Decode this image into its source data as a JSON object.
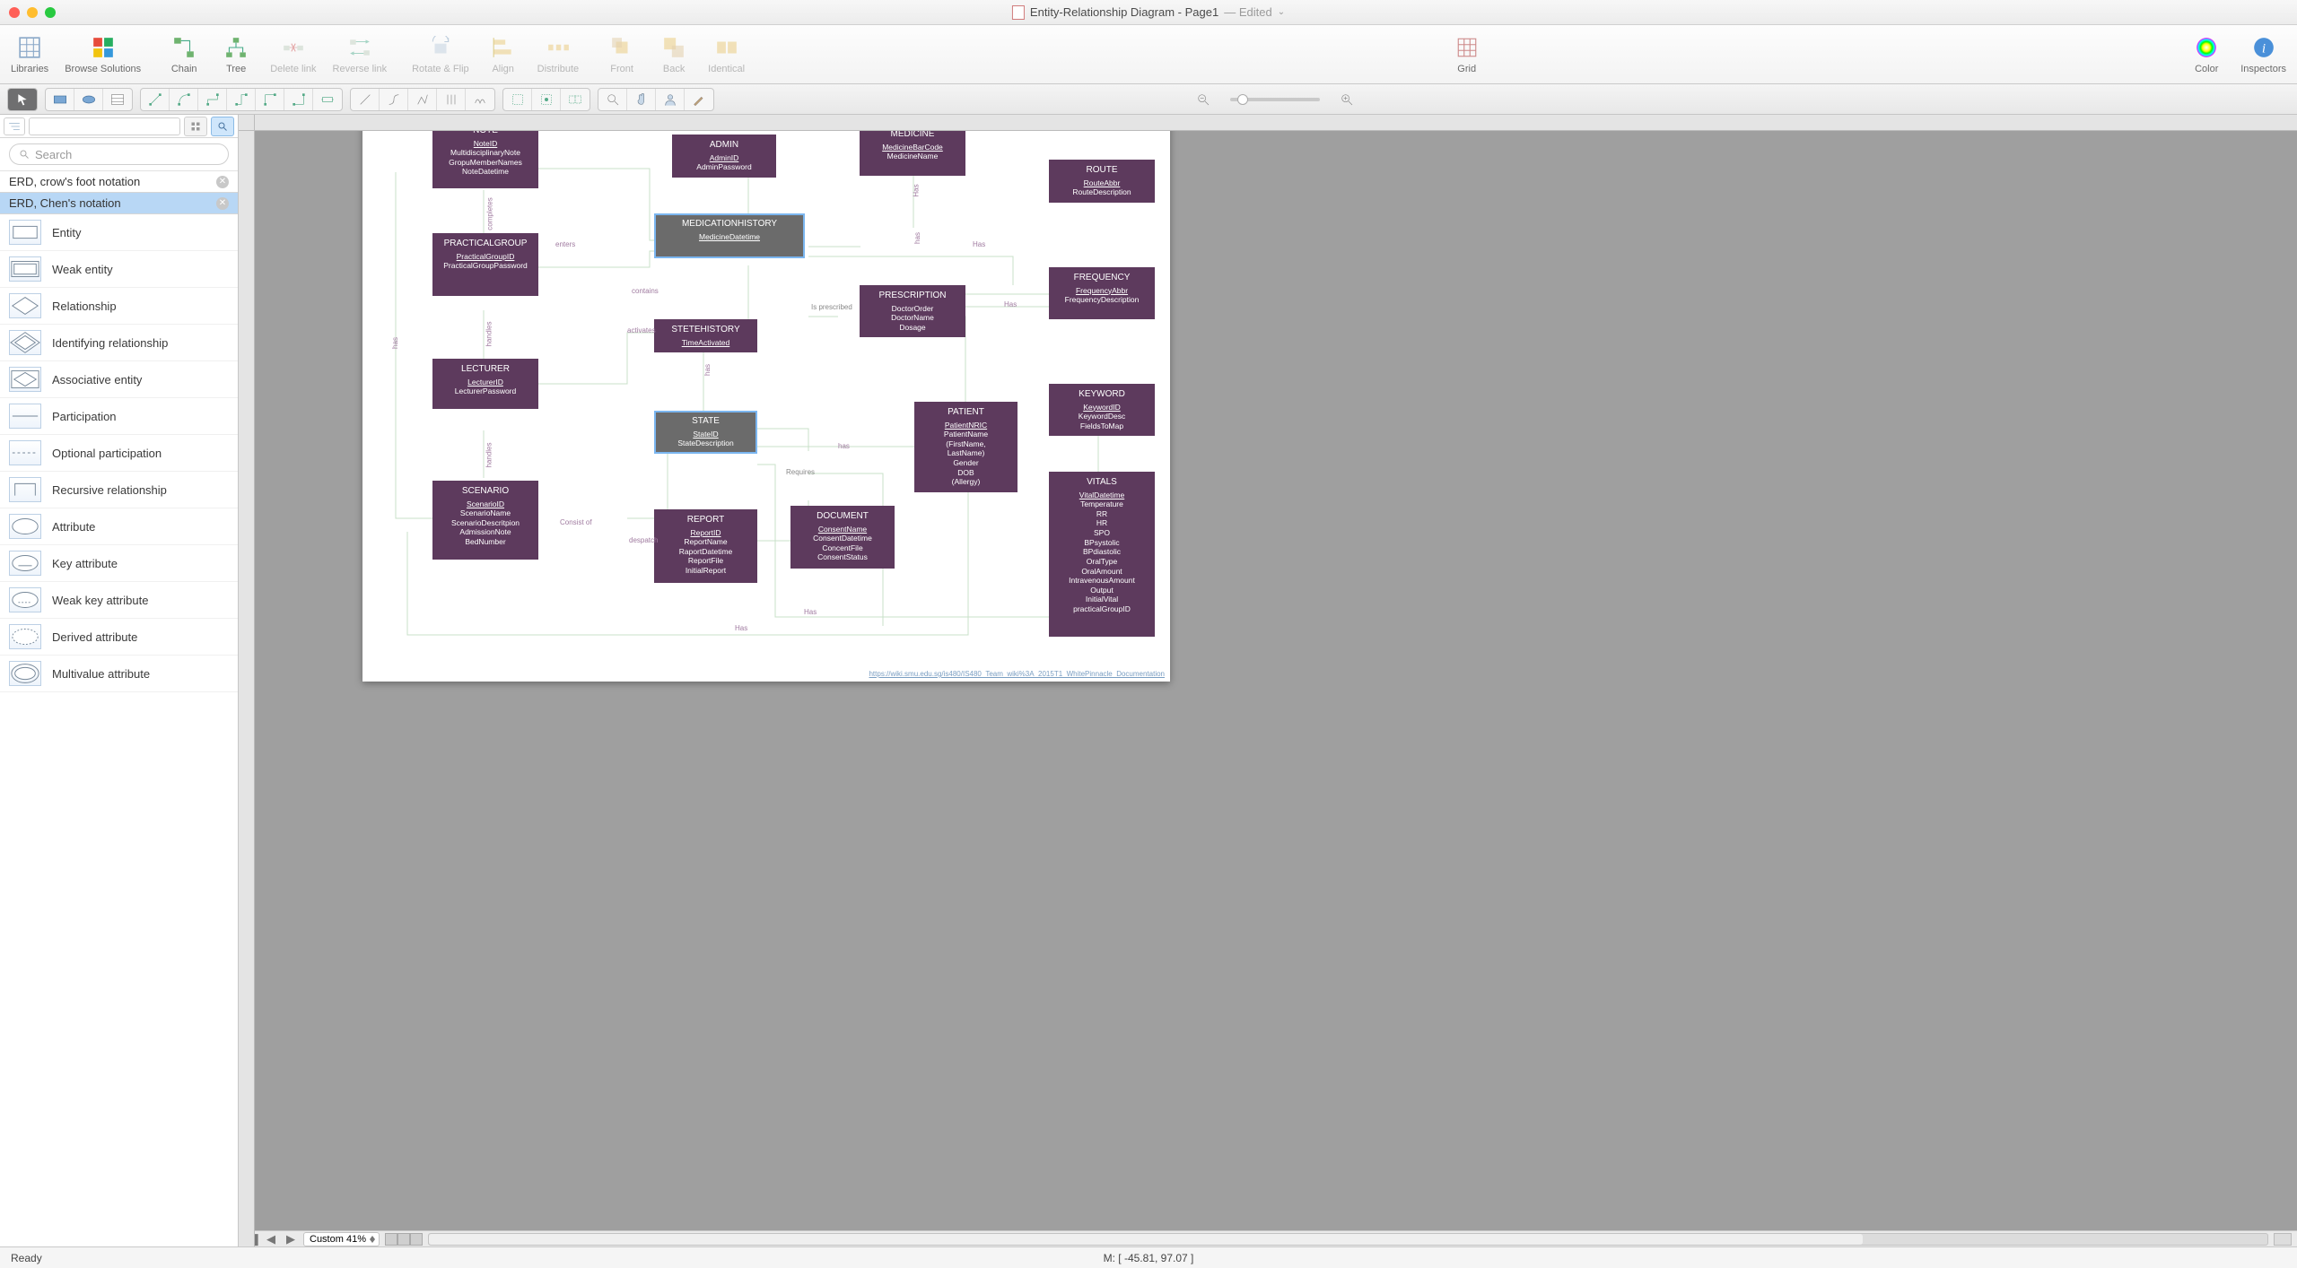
{
  "window": {
    "title": "Entity-Relationship Diagram - Page1",
    "edited": "— Edited"
  },
  "toolbar": {
    "libraries": "Libraries",
    "browse": "Browse Solutions",
    "chain": "Chain",
    "tree": "Tree",
    "delete_link": "Delete link",
    "reverse_link": "Reverse link",
    "rotate_flip": "Rotate & Flip",
    "align": "Align",
    "distribute": "Distribute",
    "front": "Front",
    "back": "Back",
    "identical": "Identical",
    "grid": "Grid",
    "color": "Color",
    "inspectors": "Inspectors"
  },
  "sidebar": {
    "search_placeholder": "Search",
    "stencil1": "ERD, crow's foot notation",
    "stencil2": "ERD, Chen's notation",
    "items": [
      "Entity",
      "Weak entity",
      "Relationship",
      "Identifying relationship",
      "Associative entity",
      "Participation",
      "Optional participation",
      "Recursive relationship",
      "Attribute",
      "Key attribute",
      "Weak key attribute",
      "Derived attribute",
      "Multivalue attribute"
    ]
  },
  "canvas": {
    "footer_url": "https://wiki.smu.edu.sg/is480/IS480_Team_wiki%3A_2015T1_WhitePinnacle_Documentation",
    "entities": {
      "note": {
        "name": "NOTE",
        "attrs": [
          "NoteID",
          "MultidisciplinaryNote",
          "GropuMemberNames",
          "NoteDatetime"
        ]
      },
      "admin": {
        "name": "ADMIN",
        "attrs": [
          "AdminID",
          "AdminPassword"
        ]
      },
      "medicine": {
        "name": "MEDICINE",
        "attrs": [
          "MedicineBarCode",
          "MedicineName"
        ]
      },
      "route": {
        "name": "ROUTE",
        "attrs": [
          "RouteAbbr",
          "RouteDescription"
        ]
      },
      "practicalgroup": {
        "name": "PRACTICALGROUP",
        "attrs": [
          "PracticalGroupID",
          "PracticalGroupPassword"
        ]
      },
      "medhistory": {
        "name": "MEDICATIONHISTORY",
        "attrs": [
          "MedicineDatetime"
        ]
      },
      "prescription": {
        "name": "PRESCRIPTION",
        "attrs": [
          "DoctorOrder",
          "DoctorName",
          "Dosage"
        ]
      },
      "frequency": {
        "name": "FREQUENCY",
        "attrs": [
          "FrequencyAbbr",
          "FrequencyDescription"
        ]
      },
      "lecturer": {
        "name": "LECTURER",
        "attrs": [
          "LecturerID",
          "LecturerPassword"
        ]
      },
      "statehistory": {
        "name": "STETEHISTORY",
        "attrs": [
          "TimeActivated"
        ]
      },
      "state": {
        "name": "STATE",
        "attrs": [
          "StateID",
          "StateDescription"
        ]
      },
      "keyword": {
        "name": "KEYWORD",
        "attrs": [
          "KeywordID",
          "KeywordDesc",
          "FieldsToMap"
        ]
      },
      "scenario": {
        "name": "SCENARIO",
        "attrs": [
          "ScenarioID",
          "ScenarioName",
          "ScenarioDescritpion",
          "AdmissionNote",
          "BedNumber"
        ]
      },
      "report": {
        "name": "REPORT",
        "attrs": [
          "ReportID",
          "ReportName",
          "RaportDatetime",
          "ReportFile",
          "InitialReport"
        ]
      },
      "document": {
        "name": "DOCUMENT",
        "attrs": [
          "ConsentName",
          "ConsentDatetime",
          "ConcentFile",
          "ConsentStatus"
        ]
      },
      "patient": {
        "name": "PATIENT",
        "attrs": [
          "PatientNRIC",
          "PatientName",
          "(FirstName,",
          "LastName)",
          "Gender",
          "DOB",
          "(Allergy)"
        ]
      },
      "vitals": {
        "name": "VITALS",
        "attrs": [
          "VitalDatetime",
          "Temperature",
          "RR",
          "HR",
          "SPO",
          "BPsystolic",
          "BPdiastolic",
          "OralType",
          "OralAmount",
          "IntravenousAmount",
          "Output",
          "InitialVital",
          "practicalGroupID"
        ]
      }
    },
    "labels": {
      "completes": "completes",
      "enters": "enters",
      "contains": "contains",
      "activates": "activates",
      "handles": "handles",
      "has": "has",
      "Has": "Has",
      "is_prescribed": "Is prescribed",
      "consist_of": "Consist of",
      "despatch": "despatch",
      "requires": "Requires"
    }
  },
  "bottom": {
    "zoom": "Custom 41%"
  },
  "status": {
    "ready": "Ready",
    "mouse": "M: [ -45.81, 97.07 ]"
  }
}
